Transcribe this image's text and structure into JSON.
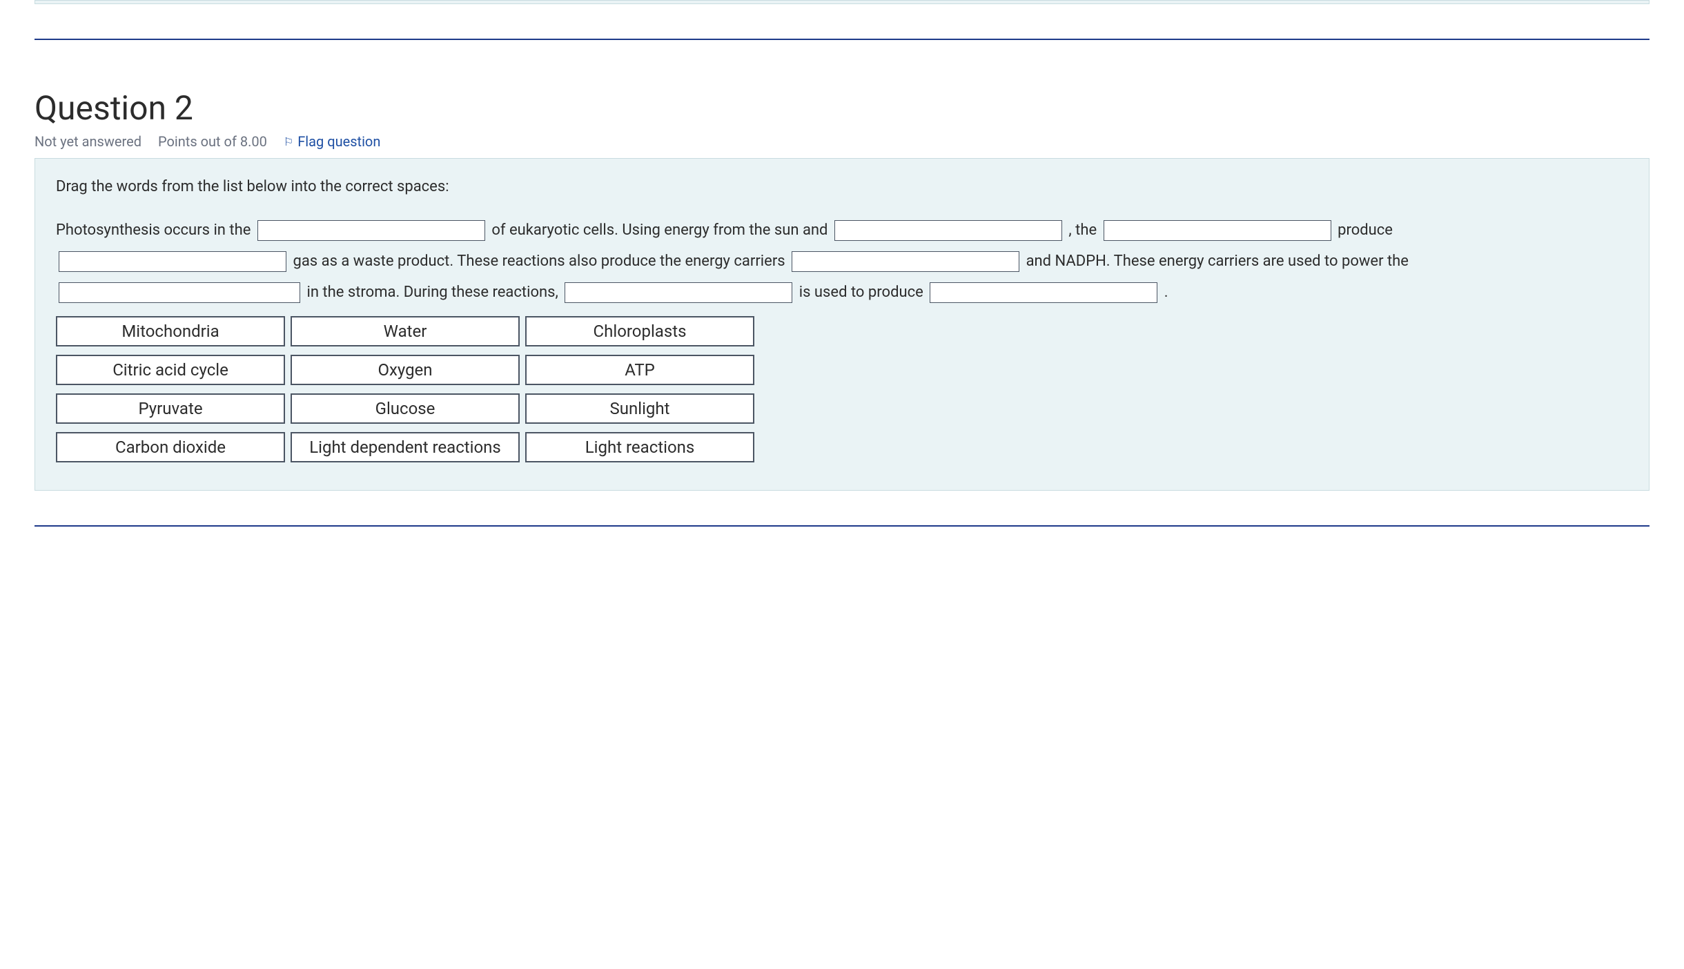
{
  "question": {
    "title": "Question 2",
    "status": "Not yet answered",
    "points": "Points out of 8.00",
    "flag": "Flag question"
  },
  "body": {
    "instructions": "Drag the words from the list below into the correct spaces:",
    "text": {
      "t1": "Photosynthesis occurs in the ",
      "t2": " of eukaryotic cells. Using energy from the sun and ",
      "t3": " , the ",
      "t4": " produce ",
      "t5": " gas as a waste product. These reactions also produce the energy carriers ",
      "t6": " and NADPH. These energy carriers are used to power the ",
      "t7": " in the stroma. During these reactions, ",
      "t8": " is used to produce ",
      "t9": " ."
    },
    "options": [
      "Mitochondria",
      "Water",
      "Chloroplasts",
      "Citric acid cycle",
      "Oxygen",
      "ATP",
      "Pyruvate",
      "Glucose",
      "Sunlight",
      "Carbon dioxide",
      "Light dependent reactions",
      "Light reactions"
    ]
  }
}
